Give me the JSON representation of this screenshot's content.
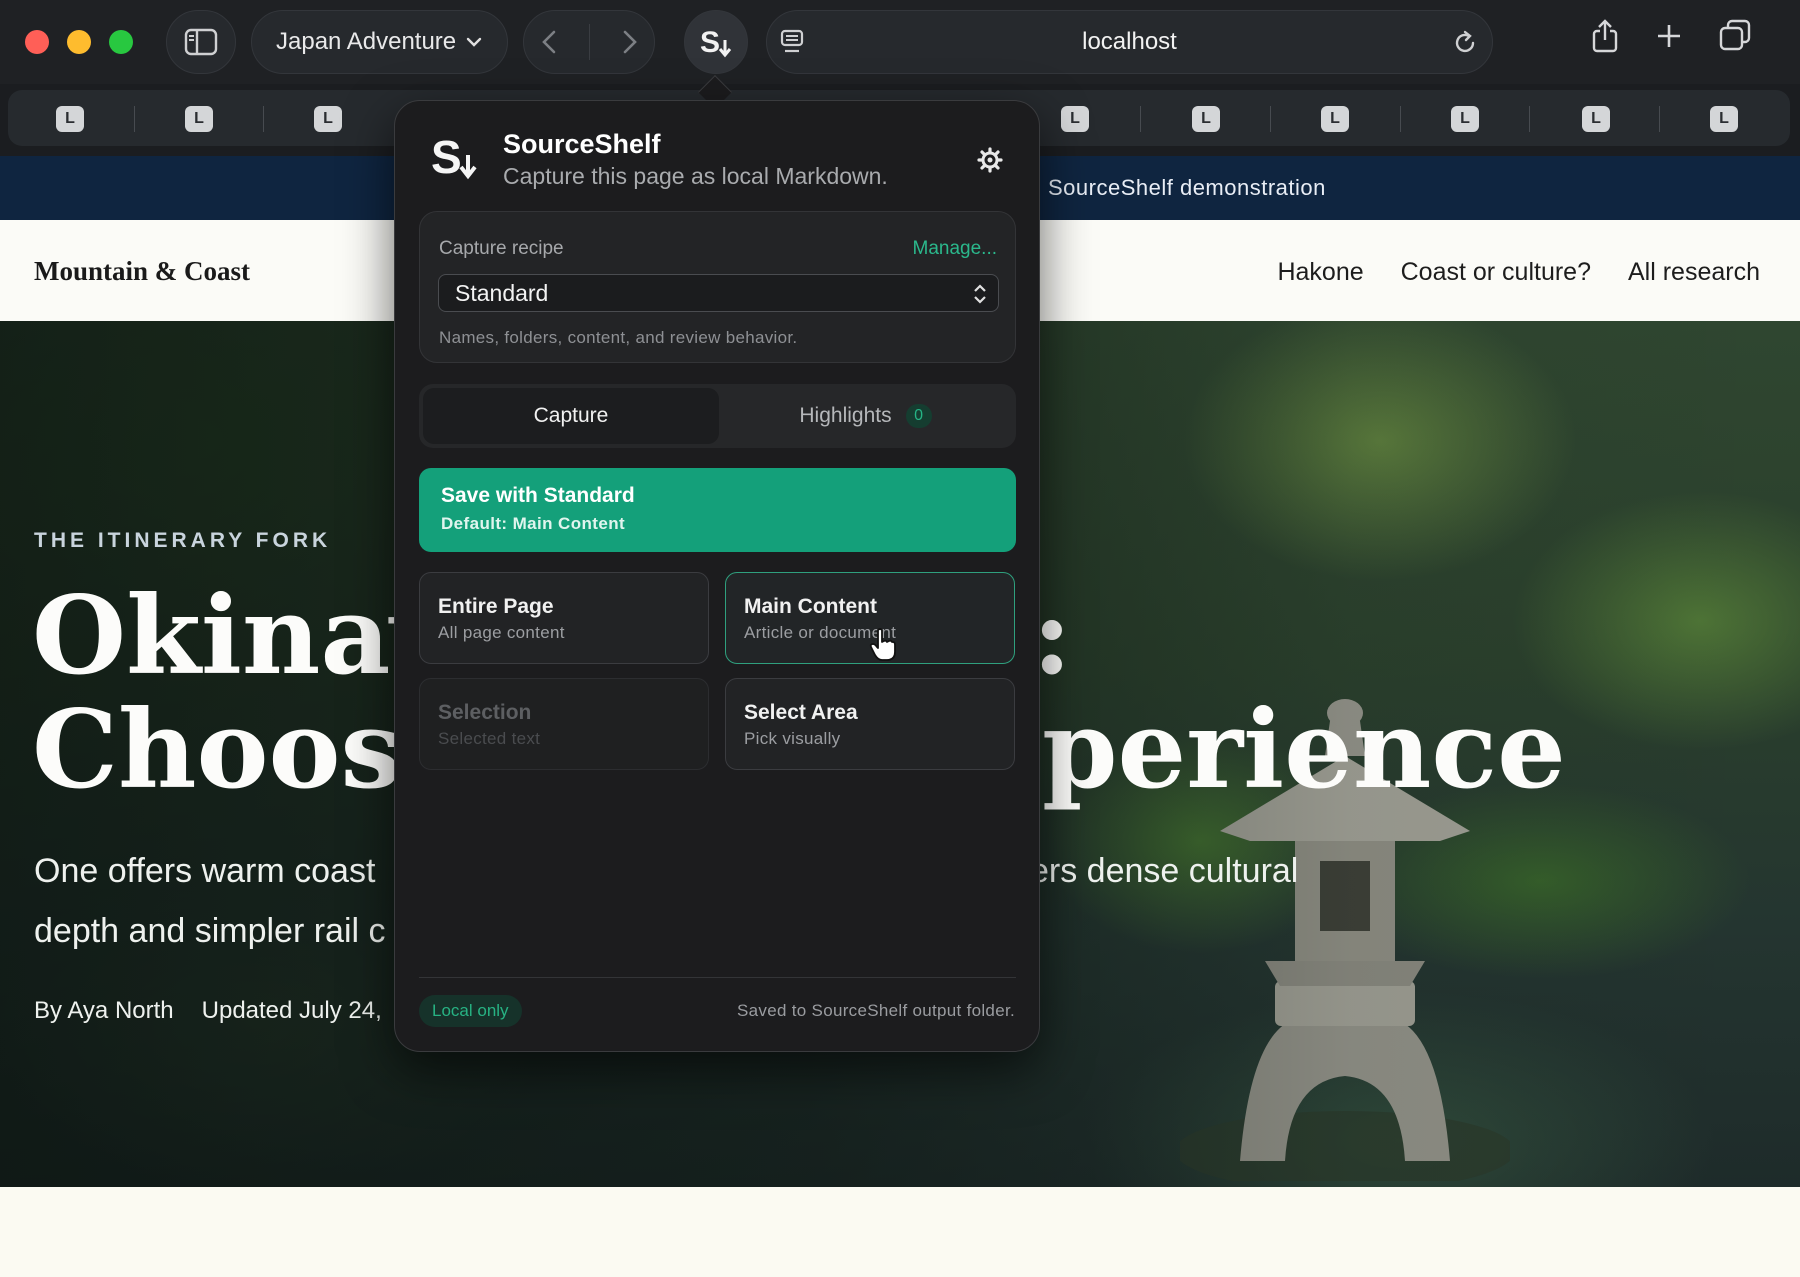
{
  "browser": {
    "tab_group": "Japan Adventure",
    "address": "localhost",
    "tab_favicon_letter": "L",
    "colors": {
      "close": "#ff5f57",
      "minimize": "#febc2e",
      "zoom": "#28c840"
    }
  },
  "page": {
    "announcement": "SourceShelf demonstration",
    "site_name": "Mountain & Coast",
    "nav": [
      "Hakone",
      "Coast or culture?",
      "All research"
    ],
    "eyebrow": "THE ITINERARY FORK",
    "hero_title_line1_left": "Okinav",
    "hero_title_line1_right": ":",
    "hero_title_line2_left": "Choos",
    "hero_title_line2_right": "perience",
    "hero_sub_line1_left": "One offers warm coast",
    "hero_sub_line1_right": "ers dense cultural",
    "hero_sub_line2_left": "depth and simpler rail c",
    "author": "By Aya North",
    "updated": "Updated July 24,"
  },
  "extension": {
    "name": "SourceShelf",
    "tagline": "Capture this page as local Markdown.",
    "recipe": {
      "label": "Capture recipe",
      "manage": "Manage...",
      "selected": "Standard",
      "description": "Names, folders, content, and review behavior."
    },
    "tabs": {
      "capture": "Capture",
      "highlights": "Highlights",
      "highlights_count": "0"
    },
    "primary": {
      "title": "Save with Standard",
      "subtitle": "Default: Main Content"
    },
    "options": [
      {
        "title": "Entire Page",
        "subtitle": "All page content"
      },
      {
        "title": "Main Content",
        "subtitle": "Article or document"
      },
      {
        "title": "Selection",
        "subtitle": "Selected text"
      },
      {
        "title": "Select Area",
        "subtitle": "Pick visually"
      }
    ],
    "footer_badge": "Local only",
    "footer_note": "Saved to SourceShelf output folder.",
    "accent": "#14a07a"
  }
}
